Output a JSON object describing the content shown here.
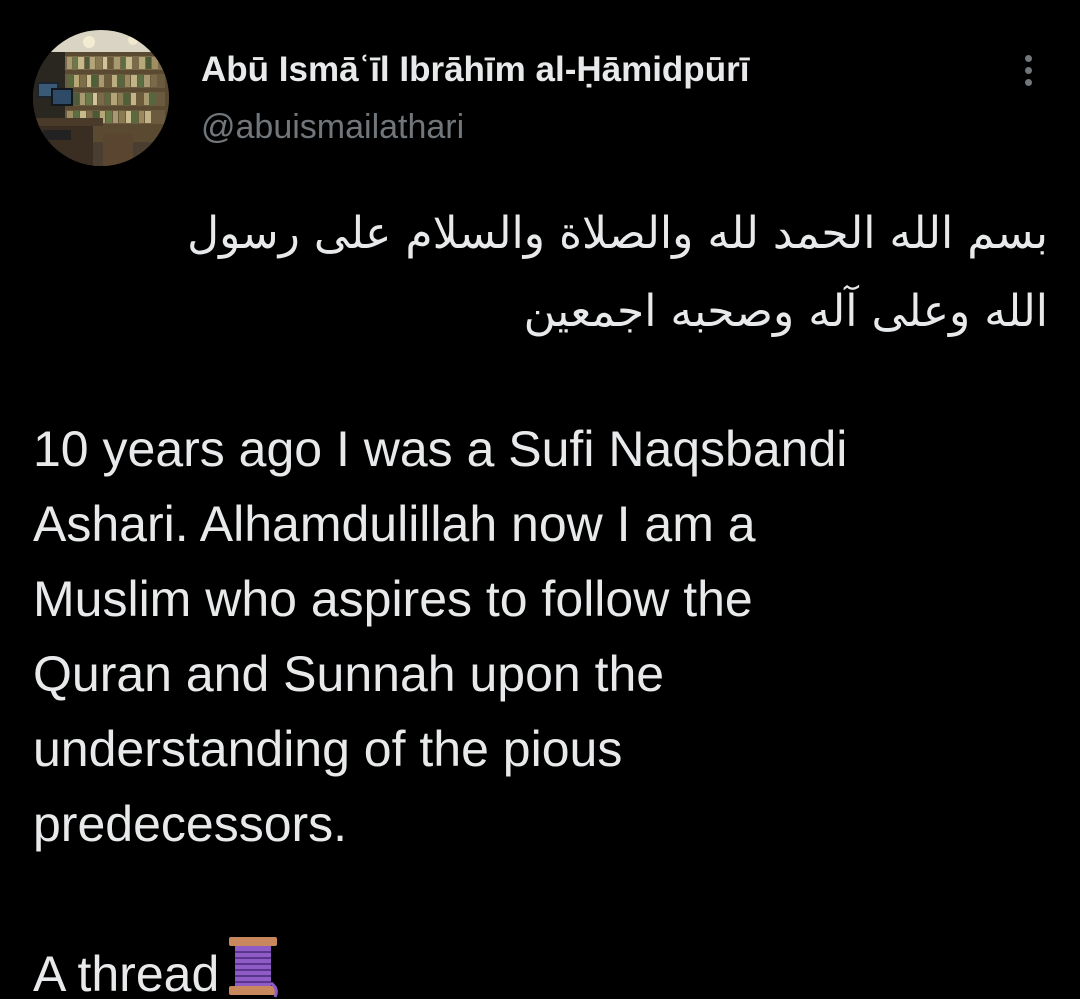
{
  "author": {
    "display_name": "Abū Ismāʿīl Ibrāhīm al-Ḥāmidpūrī",
    "handle": "@abuismailathari",
    "avatar": "library-bookshelf-avatar"
  },
  "menu": {
    "icon": "more-vertical-icon"
  },
  "tweet": {
    "arabic_lines": [
      "بسم الله الحمد لله والصلاة والسلام على رسول",
      "الله وعلى آله وصحبه اجمعين"
    ],
    "body_lines": [
      "10 years ago I was a Sufi Naqsbandi",
      "Ashari. Alhamdulillah now I am a",
      "Muslim who aspires to follow the",
      "Quran and Sunnah upon the",
      "understanding of the pious",
      "predecessors."
    ],
    "thread_text": "A thread",
    "thread_emoji": "spool-of-thread-icon"
  },
  "colors": {
    "background": "#000000",
    "primary_text": "#e7e9ea",
    "secondary_text": "#71767b"
  }
}
